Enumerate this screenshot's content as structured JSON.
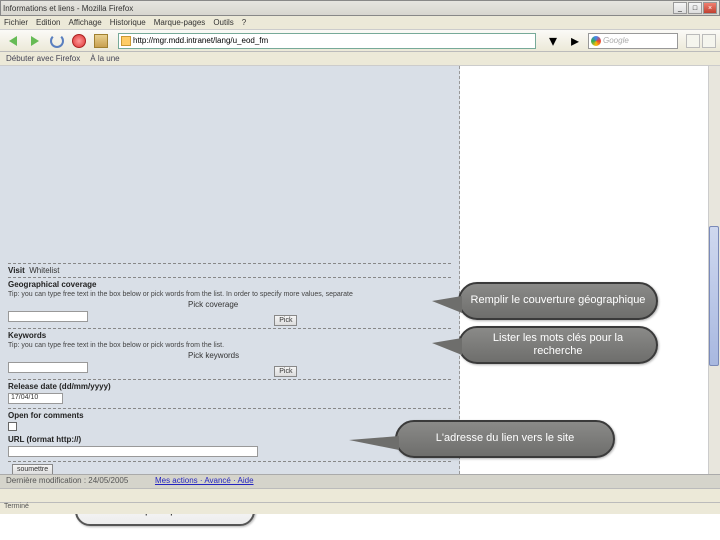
{
  "window": {
    "title": "Informations et liens - Mozilla Firefox"
  },
  "menu": {
    "items": [
      "Fichier",
      "Edition",
      "Affichage",
      "Historique",
      "Marque-pages",
      "Outils",
      "?"
    ]
  },
  "url": "http://mgr.mdd.intranet/lang/u_eod_fm",
  "search_placeholder": "Google",
  "bookmarks": {
    "a": "Débuter avec Firefox",
    "b": "À la une"
  },
  "form": {
    "visit_label": "Visit",
    "visit_value": "Whitelist",
    "geo_heading": "Geographical coverage",
    "geo_tip": "Tip: you can type free text in the box below or pick words from the list. In order to specify more values, separate",
    "pick_coverage": "Pick coverage",
    "pick_btn": "Pick",
    "kw_heading": "Keywords",
    "kw_tip": "Tip: you can type free text in the box below or pick words from the list.",
    "pick_keywords": "Pick keywords",
    "release_label": "Release date (dd/mm/yyyy)",
    "release_value": "17/04/10",
    "open_comments": "Open for comments",
    "url_label": "URL (format http://)",
    "submit": "soumettre",
    "footer_links": "Mes actions · Avancé · Aide"
  },
  "callouts": {
    "c1": "Remplir le couverture géographique",
    "c2": "Lister les mots clés pour la recherche",
    "c3": "L'adresse du lien vers le site",
    "c4": "Valider pour poursuivre"
  },
  "footer": {
    "modif": "Dernière modification : 24/05/2005"
  },
  "status": "Terminé"
}
